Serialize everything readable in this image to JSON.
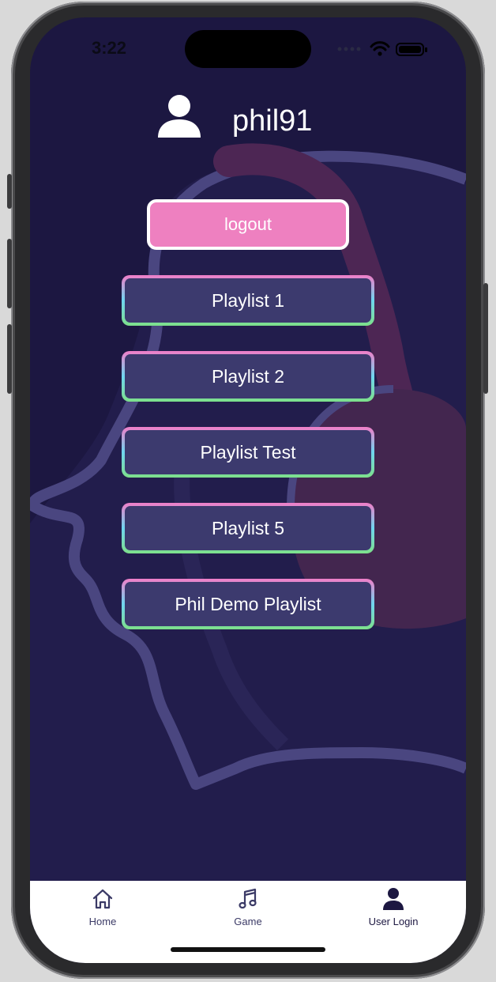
{
  "status_bar": {
    "time": "3:22"
  },
  "user": {
    "username": "phil91",
    "icon": "user-avatar-icon"
  },
  "logout": {
    "label": "logout"
  },
  "playlists": [
    {
      "label": "Playlist 1"
    },
    {
      "label": "Playlist 2"
    },
    {
      "label": "Playlist Test"
    },
    {
      "label": "Playlist 5"
    },
    {
      "label": "Phil Demo Playlist"
    }
  ],
  "tab_bar": {
    "tabs": [
      {
        "label": "Home",
        "icon": "home-icon"
      },
      {
        "label": "Game",
        "icon": "music-note-icon"
      },
      {
        "label": "User Login",
        "icon": "user-icon"
      }
    ],
    "active_tab": "User Login"
  },
  "colors": {
    "background": "#1c1741",
    "logout_fill": "#ee80c0",
    "playlist_fill": "#3c3a6e",
    "playlist_border_top": "#f07ec8",
    "playlist_border_side": "#6fd5ef",
    "playlist_border_bottom": "#7de08a",
    "tab_bar": "#ffffff"
  }
}
